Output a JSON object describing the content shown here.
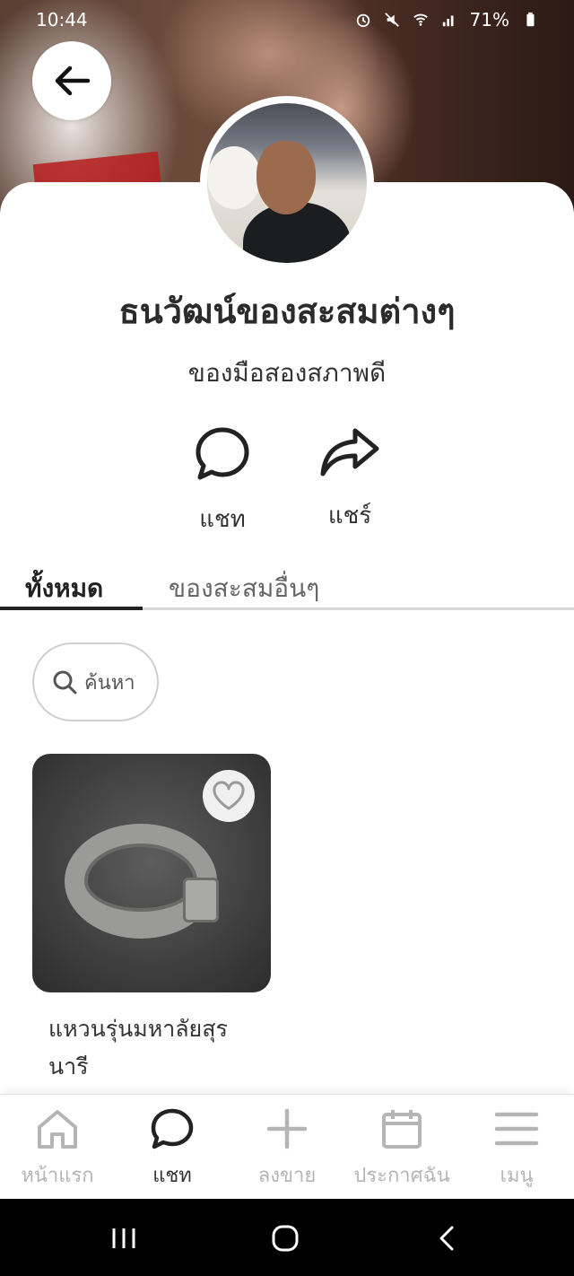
{
  "status_bar": {
    "time": "10:44",
    "battery": "71%"
  },
  "cover": {
    "description_icon": "cover-photo"
  },
  "header": {
    "back_icon": "arrow-left-icon"
  },
  "shop": {
    "name": "ธนวัฒน์ของสะสมต่างๆ",
    "description": "ของมือสองสภาพดี"
  },
  "actions": {
    "chat_label": "แชท",
    "share_label": "แชร์"
  },
  "tabs": [
    {
      "label": "ทั้งหมด",
      "active": true
    },
    {
      "label": "ของสะสมอื่นๆ",
      "active": false
    }
  ],
  "search": {
    "label": "ค้นหา"
  },
  "products": [
    {
      "title": "แหวนรุ่นมหาลัยสุรนารี"
    }
  ],
  "bottom_nav": [
    {
      "label": "หน้าแรก",
      "icon": "home-icon",
      "active": false
    },
    {
      "label": "แชท",
      "icon": "chat-icon",
      "active": true
    },
    {
      "label": "ลงขาย",
      "icon": "plus-icon",
      "active": false
    },
    {
      "label": "ประกาศฉัน",
      "icon": "calendar-icon",
      "active": false
    },
    {
      "label": "เมนู",
      "icon": "menu-icon",
      "active": false
    }
  ],
  "colors": {
    "active_text": "#333333",
    "inactive_text": "#b5b5b5",
    "tab_underline": "#222222"
  }
}
